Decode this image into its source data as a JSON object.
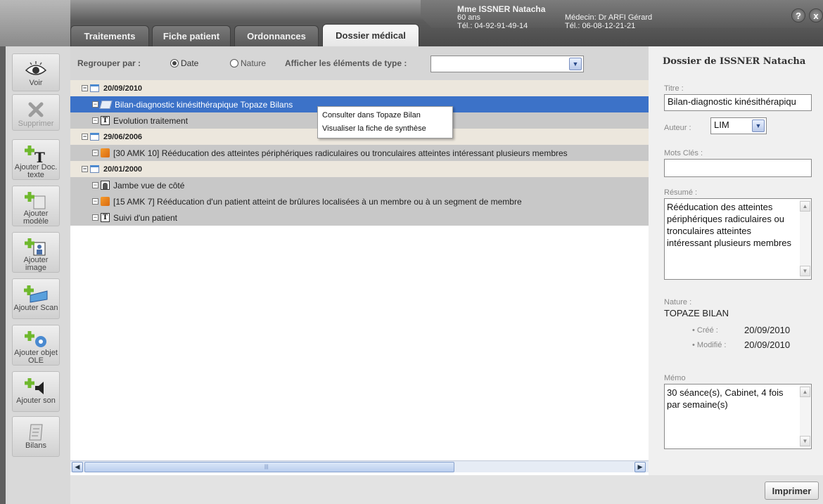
{
  "header": {
    "tabs": [
      {
        "label": "Traitements"
      },
      {
        "label": "Fiche patient"
      },
      {
        "label": "Ordonnances"
      },
      {
        "label": "Dossier médical"
      }
    ],
    "patient_name": "Mme ISSNER Natacha",
    "patient_age": "60 ans",
    "patient_phone": "Tél.: 04-92-91-49-14",
    "doctor_name": "Médecin: Dr ARFI Gérard",
    "doctor_phone": "Tél.: 06-08-12-21-21",
    "help_label": "?",
    "close_label": "x"
  },
  "toolbar": {
    "items": [
      {
        "label": "Voir",
        "icon": "eye-icon"
      },
      {
        "label": "Supprimer",
        "icon": "delete-icon"
      },
      {
        "label": "Ajouter Doc. texte",
        "icon": "add-text-icon"
      },
      {
        "label": "Ajouter modèle",
        "icon": "add-template-icon"
      },
      {
        "label": "Ajouter image",
        "icon": "add-image-icon"
      },
      {
        "label": "Ajouter Scan",
        "icon": "add-scan-icon"
      },
      {
        "label": "Ajouter objet OLE",
        "icon": "add-ole-icon"
      },
      {
        "label": "Ajouter son",
        "icon": "add-sound-icon"
      },
      {
        "label": "Bilans",
        "icon": "bilans-icon"
      }
    ]
  },
  "filter": {
    "group_label": "Regrouper par :",
    "option_date": "Date",
    "option_nature": "Nature",
    "selected": "Date",
    "type_label": "Afficher les éléments de type :",
    "type_value": ""
  },
  "tree": {
    "groups": [
      {
        "date": "20/09/2010",
        "items": [
          {
            "text": "Bilan-diagnostic kinésithérapique Topaze Bilans",
            "icon": "bilan-icon"
          },
          {
            "text": "Evolution traitement",
            "icon": "text-doc-icon"
          }
        ]
      },
      {
        "date": "29/06/2006",
        "items": [
          {
            "text": "[30 AMK 10] Rééducation des atteintes périphériques radiculaires ou tronculaires atteintes intéressant plusieurs membres",
            "icon": "treatment-icon"
          }
        ]
      },
      {
        "date": "20/01/2000",
        "items": [
          {
            "text": "Jambe vue de côté",
            "icon": "image-icon"
          },
          {
            "text": "[15 AMK 7] Rééducation d'un patient atteint de brûlures localisées à un membre ou à un segment de membre",
            "icon": "treatment-icon"
          },
          {
            "text": "Suivi d'un patient",
            "icon": "text-doc-icon"
          }
        ]
      }
    ]
  },
  "context_menu": {
    "items": [
      "Consulter dans Topaze Bilan",
      "Visualiser la fiche de synthèse"
    ]
  },
  "details": {
    "title": "Dossier de ISSNER Natacha",
    "titre_label": "Titre :",
    "titre_value": "Bilan-diagnostic kinésithérapiqu",
    "auteur_label": "Auteur :",
    "auteur_value": "LIM",
    "mots_label": "Mots Clés :",
    "mots_value": "",
    "resume_label": "Résumé :",
    "resume_value": "Rééducation des atteintes périphériques radiculaires ou tronculaires atteintes intéressant plusieurs membres",
    "nature_label": "Nature :",
    "nature_value": "TOPAZE BILAN",
    "cree_label": "• Créé :",
    "cree_value": "20/09/2010",
    "modifie_label": "• Modifié :",
    "modifie_value": "20/09/2010",
    "memo_label": "Mémo",
    "memo_value": "30 séance(s), Cabinet, 4 fois par semaine(s)"
  },
  "footer": {
    "print_label": "Imprimer"
  },
  "colors": {
    "selection": "#3c72c8",
    "date_row": "#ece7dd",
    "item_row": "#c8c8c8"
  }
}
